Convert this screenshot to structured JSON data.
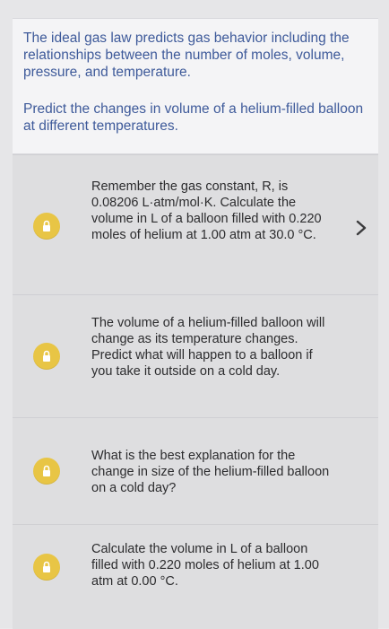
{
  "intro": {
    "paragraph1": "The ideal gas law predicts gas behavior including the relationships between the number of moles, volume, pressure, and temperature.",
    "paragraph2": "Predict the changes in volume of a helium-filled balloon at different temperatures."
  },
  "steps": [
    {
      "text": "Remember the gas constant, R, is 0.08206 L·atm/mol·K. Calculate the volume in L of a balloon filled with 0.220 moles of helium at 1.00 atm at 30.0 °C.",
      "icon": "lock-icon",
      "locked": true
    },
    {
      "text": "The volume of a helium-filled balloon will change as its temperature changes. Predict what will happen to a balloon if you take it outside on a cold day.",
      "icon": "lock-icon",
      "locked": true
    },
    {
      "text": "What is the best explanation for the change in size of the helium-filled balloon on a cold day?",
      "icon": "lock-icon",
      "locked": true
    },
    {
      "text": "Calculate the volume in L of a balloon filled with 0.220 moles of helium at 1.00 atm at 0.00 °C.",
      "icon": "lock-icon",
      "locked": true
    }
  ],
  "colors": {
    "intro_text": "#3e5a9a",
    "badge": "#e8c545",
    "step_bg": "#dedee0"
  },
  "nav": {
    "next_icon": "chevron-right-icon"
  }
}
